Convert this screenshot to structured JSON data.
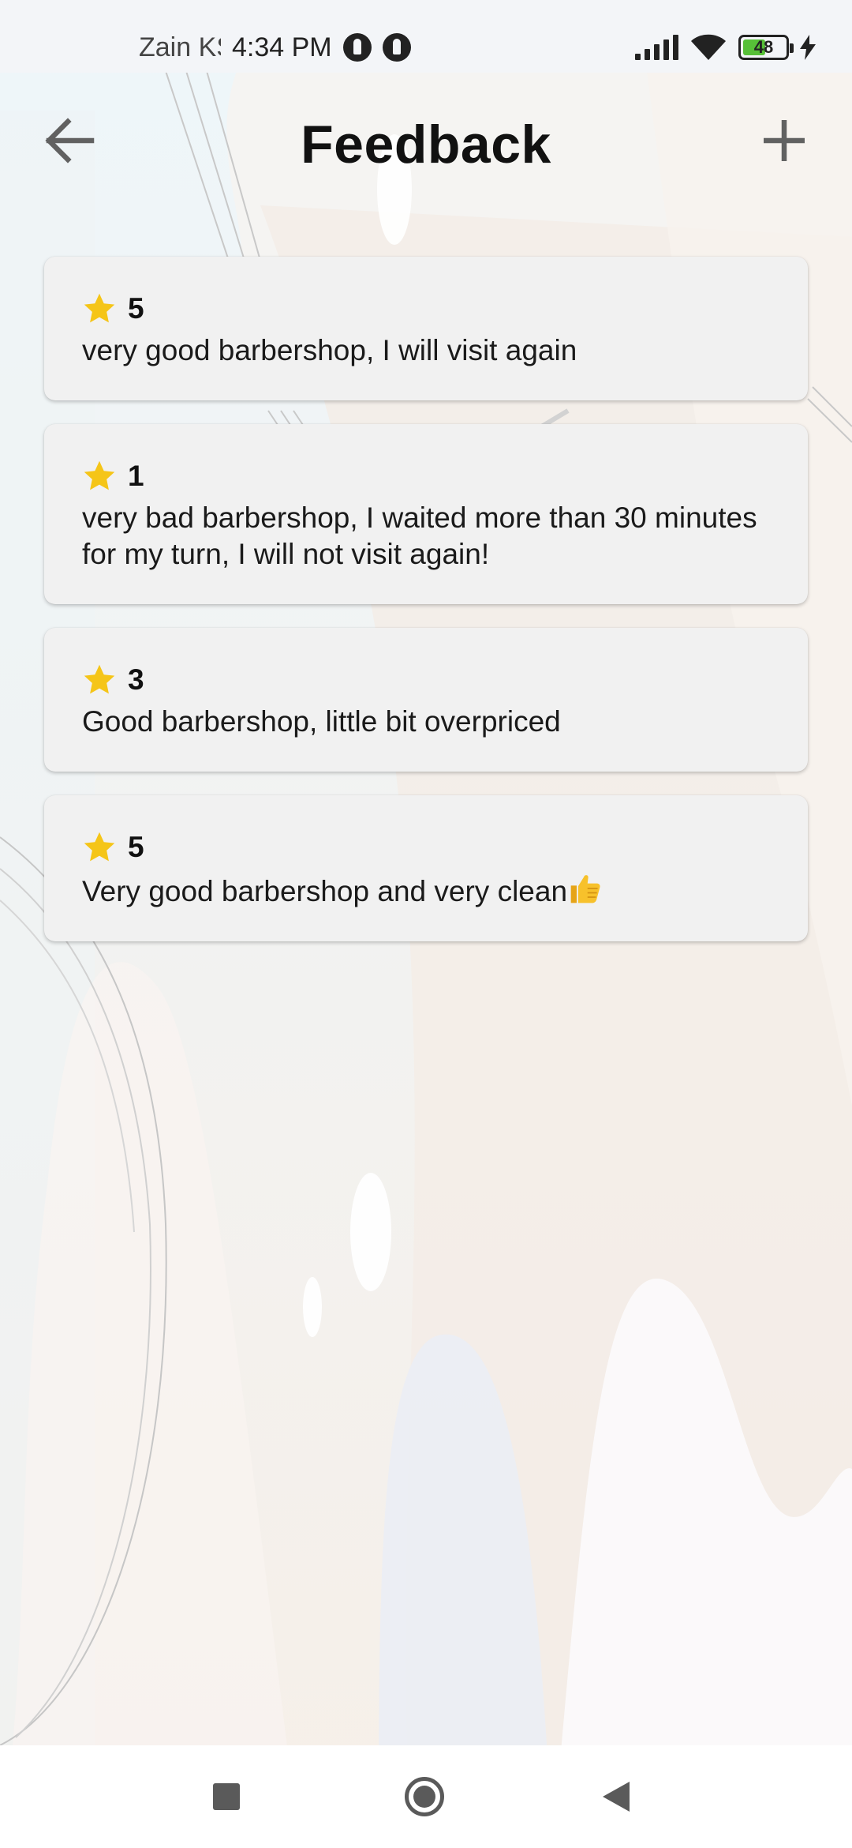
{
  "status_bar": {
    "carrier": "Zain KSA",
    "time": "4:34 PM",
    "battery": "48",
    "icons": [
      "notification-dot-icon",
      "notification-dot-icon",
      "signal-icon",
      "wifi-icon",
      "battery-icon",
      "charging-bolt-icon"
    ]
  },
  "app_bar": {
    "title": "Feedback",
    "back_icon": "arrow-left-icon",
    "add_icon": "plus-icon"
  },
  "feedback": [
    {
      "rating": "5",
      "comment": "very good barbershop, I will visit again"
    },
    {
      "rating": "1",
      "comment": "very bad barbershop, I waited more than 30 minutes for my turn, I will not visit again!"
    },
    {
      "rating": "3",
      "comment": "Good barbershop, little bit overpriced"
    },
    {
      "rating": "5",
      "comment": "Very good barbershop and very clean"
    }
  ],
  "colors": {
    "star": "#F5C518",
    "card_background": "#F1F1F1",
    "title": "#111111",
    "icon_gray": "#616161"
  },
  "nav_bar": {
    "icons": [
      "recents-square-icon",
      "home-circle-icon",
      "back-triangle-icon"
    ]
  }
}
